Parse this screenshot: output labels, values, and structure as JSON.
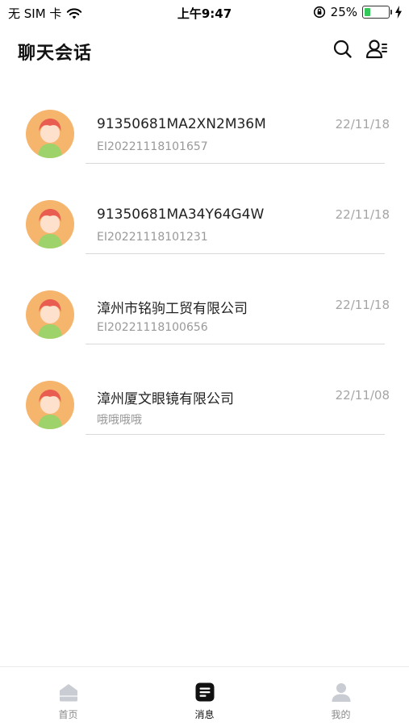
{
  "status_bar": {
    "carrier": "无 SIM 卡",
    "time": "上午9:47",
    "battery": "25%",
    "battery_level": 0.25,
    "icons": [
      "wifi-icon",
      "rotation-lock-icon",
      "battery-icon",
      "charging-bolt-icon"
    ]
  },
  "header": {
    "title": "聊天会话",
    "search_icon": "search-icon",
    "contacts_icon": "contacts-list-icon"
  },
  "conversations": [
    {
      "name": "91350681MA2XN2M36M",
      "subtitle": "EI20221118101657",
      "date": "22/11/18",
      "avatar": "avatar-icon"
    },
    {
      "name": "91350681MA34Y64G4W",
      "subtitle": "EI20221118101231",
      "date": "22/11/18",
      "avatar": "avatar-icon"
    },
    {
      "name": "漳州市铭驹工贸有限公司",
      "subtitle": "EI20221118100656",
      "date": "22/11/18",
      "avatar": "avatar-icon"
    },
    {
      "name": "漳州厦文眼镜有限公司",
      "subtitle": "哦哦哦哦",
      "date": "22/11/08",
      "avatar": "avatar-icon"
    }
  ],
  "tabbar": {
    "tabs": [
      {
        "label": "首页",
        "icon": "home-icon",
        "active": false
      },
      {
        "label": "消息",
        "icon": "message-icon",
        "active": true
      },
      {
        "label": "我的",
        "icon": "profile-icon",
        "active": false
      }
    ],
    "active_color": "#111111",
    "inactive_color": "#8a8a8a"
  },
  "colors": {
    "avatar_bg": "#f6b56c",
    "battery_fill": "#34c759"
  }
}
